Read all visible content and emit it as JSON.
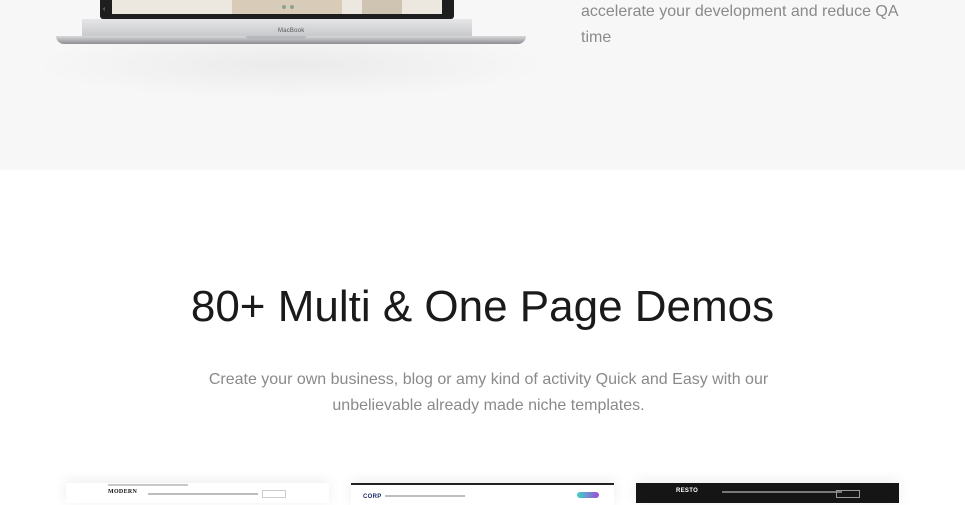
{
  "feature": {
    "text": "accelerate your development and reduce QA time",
    "laptop_brand": "MacBook"
  },
  "demos": {
    "heading": "80+ Multi & One Page Demos",
    "description": "Create your own business, blog or amy kind of activity Quick and Easy with our unbelievable already made niche templates.",
    "thumbnails": [
      {
        "logo": "MODERN"
      },
      {
        "logo": "CORP"
      },
      {
        "logo": "RESTO"
      }
    ]
  },
  "colors": {
    "band_background": "#f7f7f7",
    "heading": "#1a1a1a",
    "body_text": "#8a8a8a"
  }
}
